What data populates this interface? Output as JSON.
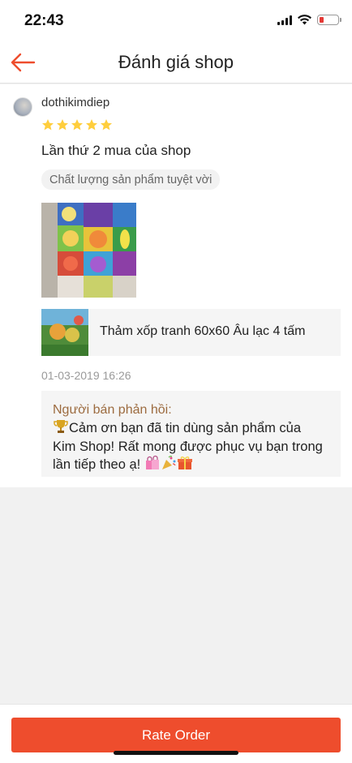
{
  "status_bar": {
    "time": "22:43"
  },
  "header": {
    "title": "Đánh giá shop",
    "back_icon": "arrow-left-icon"
  },
  "review": {
    "username": "dothikimdiep",
    "rating": 5,
    "text": "Lần thứ 2 mua của shop",
    "tag": "Chất lượng sản phẩm tuyệt vời",
    "product_name": "Thảm xốp tranh 60x60 Âu lạc 4 tấm",
    "date": "01-03-2019 16:26",
    "seller_reply": {
      "label": "Người bán phản hồi:",
      "line1": "Cảm ơn bạn đã tin dùng sản phẩm của",
      "line2": "Kim Shop! Rất mong được phục vụ bạn trong",
      "line3": "lần tiếp theo ạ!"
    }
  },
  "footer": {
    "rate_button": "Rate Order"
  },
  "colors": {
    "accent": "#ee4d2d",
    "star": "#ffce3d",
    "reply_label": "#9c6b3f"
  }
}
